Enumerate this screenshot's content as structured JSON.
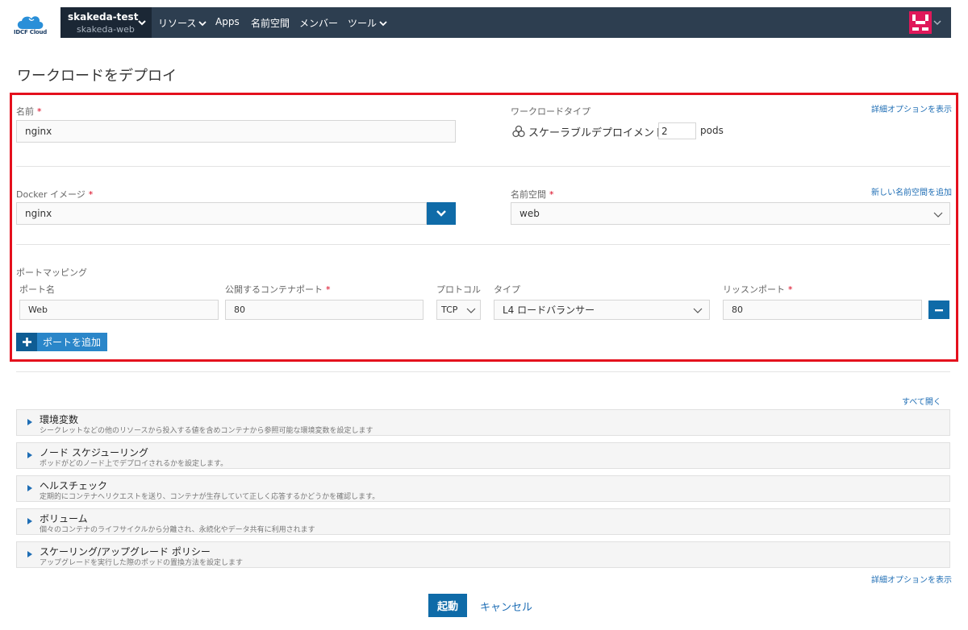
{
  "brand": {
    "logo_text": "IDCF Cloud",
    "accent": "#0f6ba8",
    "nav_bg": "#2d3e50"
  },
  "navbar": {
    "cluster": "skakeda-test",
    "project": "skakeda-web",
    "items": [
      {
        "label": "リソース",
        "has_dropdown": true
      },
      {
        "label": "Apps",
        "has_dropdown": false
      },
      {
        "label": "名前空間",
        "has_dropdown": false
      },
      {
        "label": "メンバー",
        "has_dropdown": false
      },
      {
        "label": "ツール",
        "has_dropdown": true
      }
    ]
  },
  "page_title": "ワークロードをデプロイ",
  "form": {
    "name_label": "名前",
    "required_mark": "*",
    "name_value": "nginx",
    "workload_type_label": "ワークロードタイプ",
    "workload_type_value": "スケーラブルデプロイメント:",
    "pods_count": "2",
    "pods_unit": "pods",
    "advanced_link": "詳細オプションを表示",
    "docker_image_label": "Docker イメージ",
    "docker_image_value": "nginx",
    "namespace_label": "名前空間",
    "namespace_value": "web",
    "new_namespace_link": "新しい名前空間を追加",
    "port_mapping_label": "ポートマッピング",
    "port_columns": {
      "port_name": "ポート名",
      "container_port": "公開するコンテナポート",
      "protocol": "プロトコル",
      "type": "タイプ",
      "listen_port": "リッスンポート"
    },
    "port_row": {
      "port_name": "Web",
      "container_port": "80",
      "protocol": "TCP",
      "type": "L4 ロードバランサー",
      "listen_port": "80"
    },
    "add_port_button": "ポートを追加"
  },
  "expand_all_link": "すべて開く",
  "sections": [
    {
      "title": "環境変数",
      "desc": "シークレットなどの他のリソースから投入する値を含めコンテナから参照可能な環境変数を設定します"
    },
    {
      "title": "ノード スケジューリング",
      "desc": "ポッドがどのノード上でデプロイされるかを設定します。"
    },
    {
      "title": "ヘルスチェック",
      "desc": "定期的にコンテナへリクエストを送り、コンテナが生存していて正しく応答するかどうかを確認します。"
    },
    {
      "title": "ボリューム",
      "desc": "個々のコンテナのライフサイクルから分離され、永続化やデータ共有に利用されます"
    },
    {
      "title": "スケーリング/アップグレード ポリシー",
      "desc": "アップグレードを実行した際のポッドの置換方法を設定します"
    }
  ],
  "bottom_advanced_link": "詳細オプションを表示",
  "actions": {
    "launch": "起動",
    "cancel": "キャンセル"
  }
}
